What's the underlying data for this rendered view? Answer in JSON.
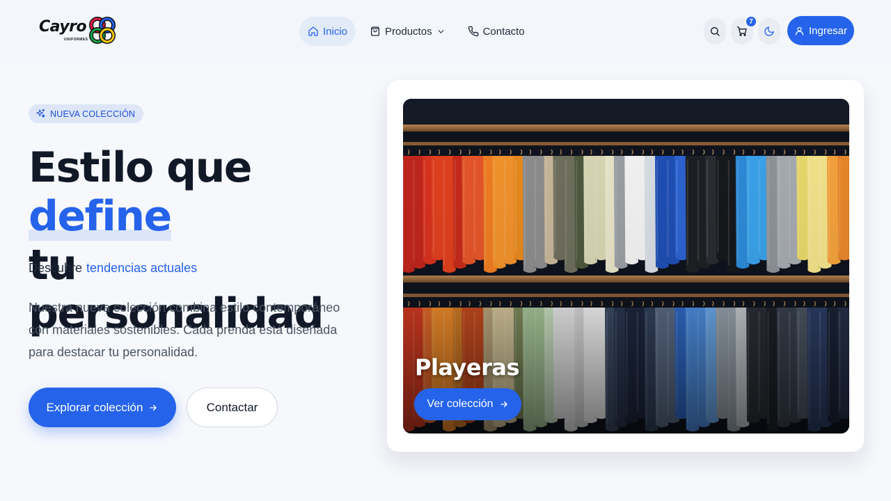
{
  "brand": {
    "name": "Cayro",
    "sub": "UNIFORMES"
  },
  "nav": {
    "items": [
      {
        "label": "Inicio",
        "icon": "home-icon",
        "active": true
      },
      {
        "label": "Productos",
        "icon": "bag-icon",
        "dropdown": true
      },
      {
        "label": "Contacto",
        "icon": "phone-icon"
      }
    ]
  },
  "header_actions": {
    "cart_count": "7",
    "login_label": "Ingresar"
  },
  "hero": {
    "badge": "NUEVA COLECCIÓN",
    "title_line1": "Estilo que",
    "title_accent": "define",
    "title_line2": "tu personalidad",
    "tagline_prefix": "Descubre",
    "tagline_highlight": "tendencias actuales",
    "description": "Nuestra nueva colección combina estilo contemporáneo con materiales sostenibles. Cada prenda está diseñada para destacar tu personalidad.",
    "primary_button": "Explorar colección",
    "secondary_button": "Contactar"
  },
  "feature_card": {
    "title": "Playeras",
    "button": "Ver colección"
  },
  "colors": {
    "accent": "#2563eb",
    "background": "#f6f8fc",
    "text": "#111827"
  }
}
